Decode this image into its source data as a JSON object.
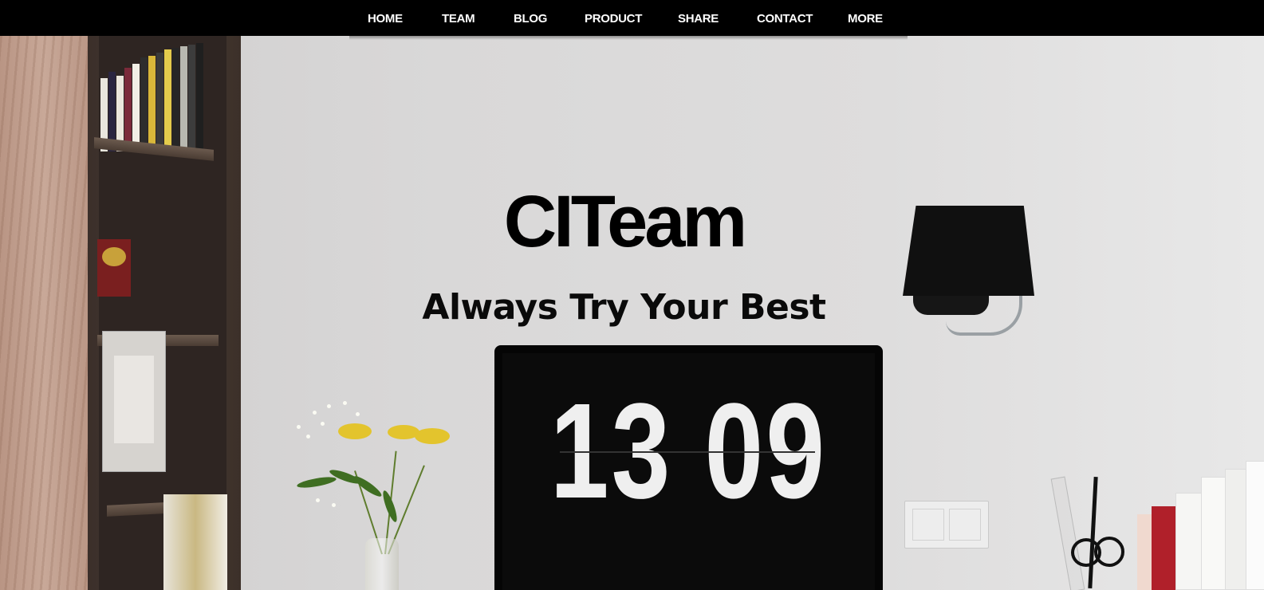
{
  "nav": {
    "items": [
      {
        "label": "HOME"
      },
      {
        "label": "TEAM"
      },
      {
        "label": "BLOG"
      },
      {
        "label": "PRODUCT"
      },
      {
        "label": "SHARE"
      },
      {
        "label": "CONTACT"
      },
      {
        "label": "MORE"
      }
    ]
  },
  "hero": {
    "title": "CITeam",
    "tagline": "Always Try Your Best",
    "clock_display": "13 09"
  },
  "colors": {
    "nav_background": "#000000",
    "nav_text": "#ffffff",
    "hero_text": "#000000"
  }
}
